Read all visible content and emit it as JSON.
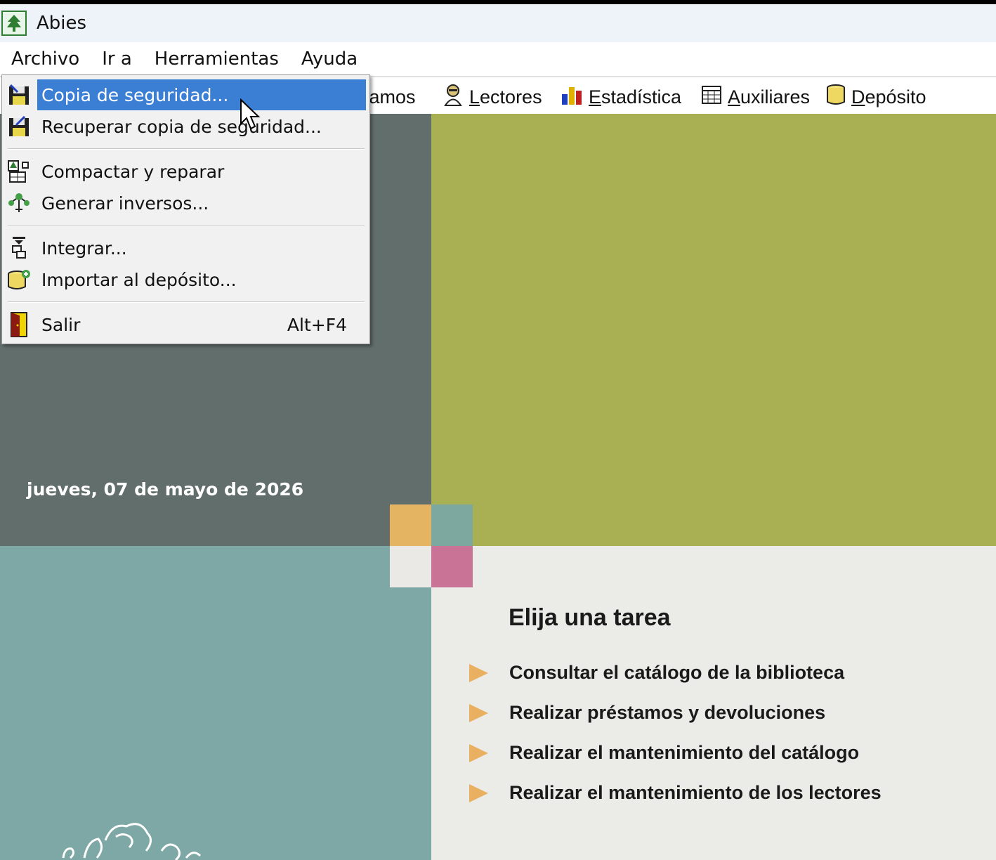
{
  "window": {
    "title": "Abies"
  },
  "menubar": {
    "items": [
      "Archivo",
      "Ir a",
      "Herramientas",
      "Ayuda"
    ]
  },
  "toolbar": {
    "partial_label": "tamos",
    "lectores": {
      "u": "L",
      "rest": "ectores"
    },
    "estadistica": {
      "u": "E",
      "rest": "stadística"
    },
    "auxiliares": {
      "u": "A",
      "rest": "uxiliares"
    },
    "deposito": {
      "u": "D",
      "rest": "epósito"
    }
  },
  "archivo_menu": {
    "copia": "Copia de seguridad...",
    "recuperar": "Recuperar copia de seguridad...",
    "compactar": "Compactar y reparar",
    "generar": "Generar inversos...",
    "integrar": "Integrar...",
    "importar": "Importar al depósito...",
    "salir": "Salir",
    "salir_shortcut": "Alt+F4"
  },
  "home": {
    "date": "jueves, 07 de mayo de 2026",
    "tasks_title": "Elija una tarea",
    "tasks": [
      "Consultar el catálogo de la biblioteca",
      "Realizar préstamos y devoluciones",
      "Realizar el mantenimiento del catálogo",
      "Realizar el mantenimiento de los lectores"
    ]
  },
  "colors": {
    "dark_panel": "#626e6b",
    "olive_panel": "#a8b053",
    "teal_panel": "#7da8a6",
    "light_panel": "#ebece8",
    "menu_highlight": "#3b7fd4",
    "task_arrow": "#e9b062",
    "accent_orange": "#e5b462",
    "accent_pink": "#c97497"
  }
}
